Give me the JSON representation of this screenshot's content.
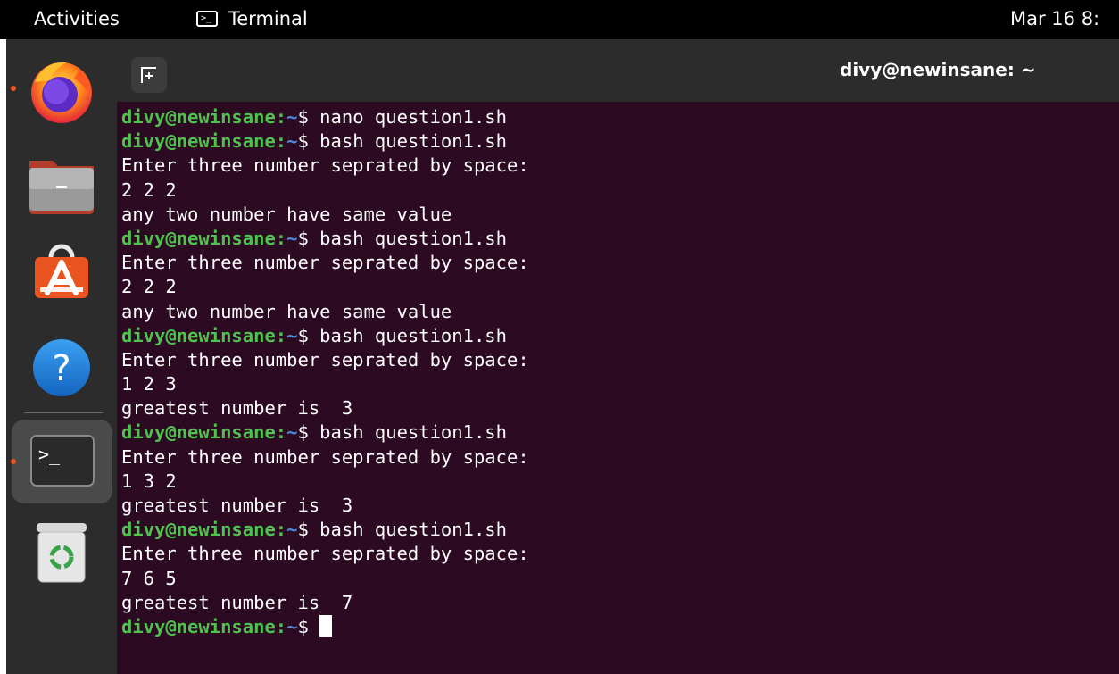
{
  "topbar": {
    "activities": "Activities",
    "app_name": "Terminal",
    "clock": "Mar 16  8:"
  },
  "dock": {
    "apps": [
      {
        "name": "Firefox",
        "icon": "firefox-icon",
        "running": true
      },
      {
        "name": "Files",
        "icon": "files-icon",
        "running": false
      },
      {
        "name": "Ubuntu Software",
        "icon": "software-icon",
        "running": false
      },
      {
        "name": "Help",
        "icon": "help-icon",
        "running": false
      },
      {
        "name": "Terminal",
        "icon": "terminal-icon",
        "running": true
      },
      {
        "name": "Trash",
        "icon": "trash-icon",
        "running": false
      }
    ]
  },
  "terminal": {
    "title": "divy@newinsane: ~",
    "prompt_user": "divy@newinsane",
    "prompt_sep": ":",
    "prompt_path": "~",
    "prompt_symbol": "$ ",
    "lines": [
      {
        "type": "prompt",
        "text": "nano question1.sh"
      },
      {
        "type": "prompt",
        "text": "bash question1.sh"
      },
      {
        "type": "output",
        "text": "Enter three number seprated by space:"
      },
      {
        "type": "output",
        "text": "2 2 2"
      },
      {
        "type": "output",
        "text": "any two number have same value"
      },
      {
        "type": "prompt",
        "text": "bash question1.sh"
      },
      {
        "type": "output",
        "text": "Enter three number seprated by space:"
      },
      {
        "type": "output",
        "text": "2 2 2"
      },
      {
        "type": "output",
        "text": "any two number have same value"
      },
      {
        "type": "prompt",
        "text": "bash question1.sh"
      },
      {
        "type": "output",
        "text": "Enter three number seprated by space:"
      },
      {
        "type": "output",
        "text": "1 2 3"
      },
      {
        "type": "output",
        "text": "greatest number is  3"
      },
      {
        "type": "prompt",
        "text": "bash question1.sh"
      },
      {
        "type": "output",
        "text": "Enter three number seprated by space:"
      },
      {
        "type": "output",
        "text": "1 3 2"
      },
      {
        "type": "output",
        "text": "greatest number is  3"
      },
      {
        "type": "prompt",
        "text": "bash question1.sh"
      },
      {
        "type": "output",
        "text": "Enter three number seprated by space:"
      },
      {
        "type": "output",
        "text": "7 6 5"
      },
      {
        "type": "output",
        "text": "greatest number is  7"
      },
      {
        "type": "prompt",
        "text": "",
        "cursor": true
      }
    ]
  },
  "colors": {
    "terminal_bg": "#2c0a22",
    "prompt_user": "#4ec44e",
    "prompt_path": "#4a8ad9",
    "accent": "#e95420"
  }
}
